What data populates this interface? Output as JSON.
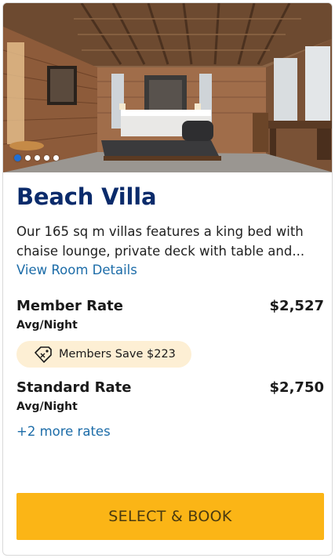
{
  "room": {
    "image_alt": "Beach Villa bedroom photo",
    "carousel_count": 5,
    "carousel_active": 0,
    "title": "Beach Villa",
    "description": "Our 165 sq m villas features a king bed with chaise lounge, private deck with table and...",
    "details_link": "View Room Details"
  },
  "rates": {
    "member": {
      "name": "Member Rate",
      "price": "$2,527",
      "unit": "Avg/Night",
      "savings_badge": "Members Save $223",
      "badge_icon": "tag-icon"
    },
    "standard": {
      "name": "Standard Rate",
      "price": "$2,750",
      "unit": "Avg/Night"
    },
    "more_rates": "+2 more rates"
  },
  "actions": {
    "book_label": "SELECT & BOOK"
  },
  "colors": {
    "title": "#0b2b6b",
    "link": "#1c6ca8",
    "book_button": "#fbb516",
    "badge_bg": "#fdefd4",
    "dot_active": "#1f6fd6"
  }
}
